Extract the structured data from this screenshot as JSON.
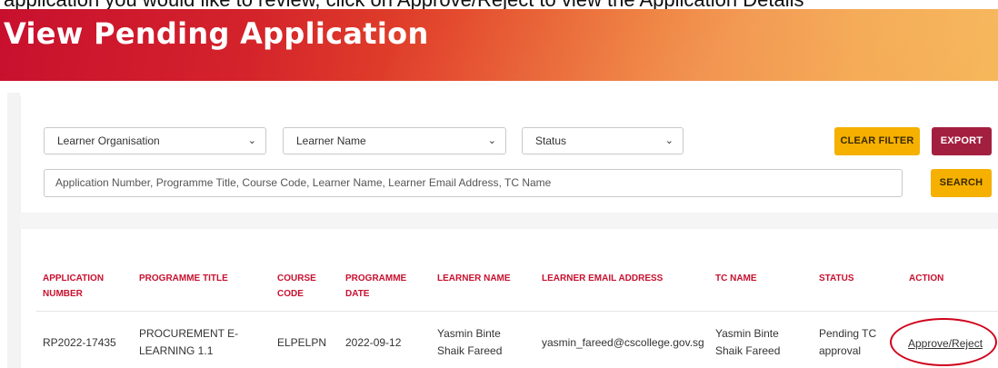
{
  "page": {
    "top_cut_text": "application you would like to review, click on Approve/Reject to view the Application Details",
    "title": "View Pending Application"
  },
  "filters": {
    "learner_organisation": "Learner Organisation",
    "learner_name": "Learner Name",
    "status": "Status",
    "clear_filter_label": "CLEAR FILTER",
    "export_label": "EXPORT",
    "search_placeholder": "Application Number, Programme Title, Course Code, Learner Name, Learner Email Address, TC Name",
    "search_label": "SEARCH"
  },
  "table": {
    "headers": {
      "application_number": [
        "APPLICATION",
        "NUMBER"
      ],
      "programme_title": "PROGRAMME TITLE",
      "course_code": [
        "COURSE",
        "CODE"
      ],
      "programme_date": [
        "PROGRAMME",
        "DATE"
      ],
      "learner_name": "LEARNER NAME",
      "learner_email": "LEARNER EMAIL ADDRESS",
      "tc_name": "TC NAME",
      "status": "STATUS",
      "action": "ACTION"
    },
    "rows": [
      {
        "application_number": "RP2022-17435",
        "programme_title": [
          "PROCUREMENT E-",
          "LEARNING 1.1"
        ],
        "course_code": "ELPELPN",
        "programme_date": "2022-09-12",
        "learner_name": [
          "Yasmin Binte",
          "Shaik Fareed"
        ],
        "learner_email": "yasmin_fareed@cscollege.gov.sg",
        "tc_name": [
          "Yasmin Binte",
          "Shaik Fareed"
        ],
        "status": [
          "Pending TC",
          "approval"
        ],
        "action": "Approve/Reject"
      }
    ]
  },
  "icons": {
    "dropdown": "chevron-down-icon"
  },
  "colors": {
    "header_red": "#c8102e",
    "yellow_button": "#f5b000",
    "export_button": "#a31f3f",
    "highlight_ellipse": "#d0021b"
  }
}
